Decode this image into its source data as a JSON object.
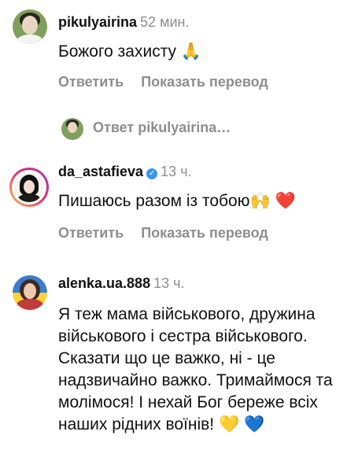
{
  "comments": [
    {
      "username": "pikulyairina",
      "time": "52 мин.",
      "text": "Божого захисту 🙏",
      "reply_label": "Ответить",
      "translate_label": "Показать перевод"
    },
    {
      "username": "da_astafieva",
      "verified": true,
      "time": "13 ч.",
      "text": "Пишаюсь разом із тобою🙌 ❤️",
      "reply_label": "Ответить",
      "translate_label": "Показать перевод"
    },
    {
      "username": "alenka.ua.888",
      "time": "13 ч.",
      "text": "Я теж мама військового, дружина військового і сестра військового. Сказати що це важко, ні - це надзвичайно важко. Тримаймося та молімося! І нехай Бог береже всіх наших рідних воїнів! 💛 💙"
    }
  ],
  "reply_thread": {
    "label": "Ответ",
    "username": "pikulyairina…"
  }
}
